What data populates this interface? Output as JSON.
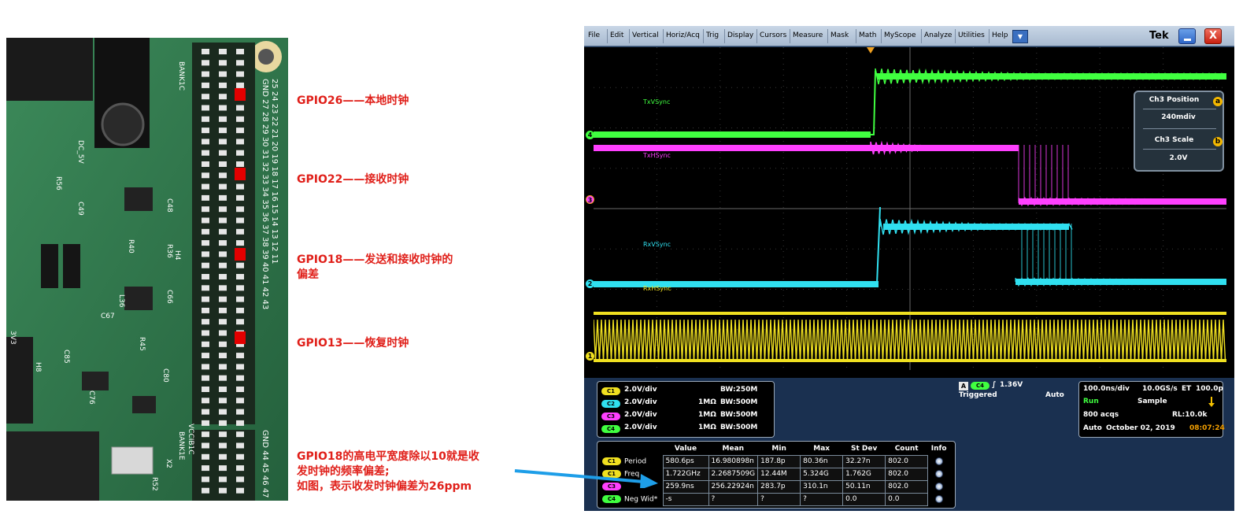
{
  "annotations": {
    "gpio26": "GPIO26——本地时钟",
    "gpio22": "GPIO22——接收时钟",
    "gpio18_line1": "GPIO18——发送和接收时钟的",
    "gpio18_line2": "偏差",
    "gpio13": "GPIO13——恢复时钟",
    "note_line1": "GPIO18的高电平宽度除以10就是收",
    "note_line2": "发时钟的频率偏差;",
    "note_line3": "如图，表示收发时钟偏差为26ppm"
  },
  "pcb": {
    "labels": {
      "dc5v": "DC_5V",
      "h4": "H4",
      "bank1c": "BANK1C",
      "bank1e": "BANK1E",
      "vccib1c": "VCCIB1C",
      "c49": "C49",
      "c48": "C48",
      "c66": "C66",
      "c67": "C67",
      "c80": "C80",
      "c85": "C85",
      "r45": "R45",
      "r36": "R36",
      "r40": "R40",
      "x2": "X2",
      "r52": "R52",
      "h8": "H8",
      "l36": "L36",
      "r56": "R56",
      "c76": "C76",
      "v3v3": "3V3",
      "upper_pins": "GND 27 28 29 30 31 32 33 34 35 36 37 38 39 40 41 42 43",
      "lower_pins": "GND 44 45 46 47",
      "right_numbers": "25 24 23 22 21 20 19 18 17 16 15 14 13 12 11"
    }
  },
  "scope": {
    "menu": [
      "File",
      "Edit",
      "Vertical",
      "Horiz/Acq",
      "Trig",
      "Display",
      "Cursors",
      "Measure",
      "Mask",
      "Math",
      "MyScope",
      "Analyze",
      "Utilities",
      "Help"
    ],
    "logo": "Tek",
    "close_glyph": "X",
    "dropdown_glyph": "▼",
    "trace_labels": {
      "txv": "TxVSync",
      "txh": "TxHSync",
      "rxv": "RxVSync",
      "rxh": "RxHSync"
    },
    "channel_markers": [
      "4",
      "3",
      "2",
      "1"
    ],
    "ch3_panel": {
      "position_title": "Ch3 Position",
      "position_value": "240mdiv",
      "scale_title": "Ch3 Scale",
      "scale_value": "2.0V",
      "knob_a": "a",
      "knob_b": "b"
    },
    "channel_settings": [
      {
        "badge": "C1",
        "scale": "2.0V/div",
        "imp": "",
        "bw": "BW:250M",
        "color": "#f0e020"
      },
      {
        "badge": "C2",
        "scale": "2.0V/div",
        "imp": "1MΩ",
        "bw": "BW:500M",
        "color": "#30e0f0"
      },
      {
        "badge": "C3",
        "scale": "2.0V/div",
        "imp": "1MΩ",
        "bw": "BW:500M",
        "color": "#ff40ff"
      },
      {
        "badge": "C4",
        "scale": "2.0V/div",
        "imp": "1MΩ",
        "bw": "BW:500M",
        "color": "#40ff40"
      }
    ],
    "trigger": {
      "label_a": "A",
      "badge": "C4",
      "slope": "∫",
      "level": "1.36V",
      "state": "Triggered",
      "mode": "Auto"
    },
    "timebase": {
      "horiz": "100.0ns/div",
      "rate": "10.0GS/s",
      "et": "ET",
      "res": "100.0p",
      "run": "Run",
      "sample": "Sample",
      "acqs": "800 acqs",
      "rl": "RL:10.0k",
      "auto": "Auto",
      "date": "October 02, 2019",
      "time": "08:07:24"
    },
    "measurements": {
      "headers": [
        "",
        "Value",
        "Mean",
        "Min",
        "Max",
        "St Dev",
        "Count",
        "Info"
      ],
      "rows": [
        {
          "badge": "C1",
          "name": "Period",
          "value": "580.6ps",
          "mean": "16.980898n",
          "min": "187.8p",
          "max": "80.36n",
          "stdev": "32.27n",
          "count": "802.0"
        },
        {
          "badge": "C1",
          "name": "Freq",
          "value": "1.722GHz",
          "mean": "2.2687509G",
          "min": "12.44M",
          "max": "5.324G",
          "stdev": "1.762G",
          "count": "802.0"
        },
        {
          "badge": "C3",
          "name": "",
          "value": "259.9ns",
          "mean": "256.22924n",
          "min": "283.7p",
          "max": "310.1n",
          "stdev": "50.11n",
          "count": "802.0"
        },
        {
          "badge": "C4",
          "name": "Neg Wid*",
          "value": "-s",
          "mean": "?",
          "min": "?",
          "max": "?",
          "stdev": "0.0",
          "count": "0.0"
        }
      ]
    }
  },
  "colors": {
    "annotation": "#e0201a",
    "ch1": "#f0e020",
    "ch2": "#30e0f0",
    "ch3": "#ff40ff",
    "ch4": "#40ff40",
    "arrow": "#1e9ee8"
  }
}
